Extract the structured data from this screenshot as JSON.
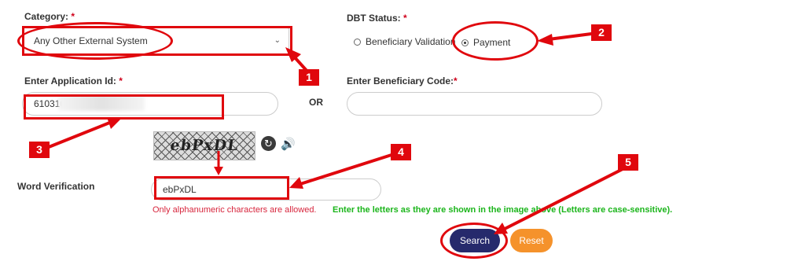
{
  "form": {
    "category": {
      "label": "Category:",
      "required": "*",
      "value": "Any Other External System",
      "chevron": "chevron-down-icon"
    },
    "dbt_status": {
      "label": "DBT Status:",
      "required": "*",
      "options": [
        {
          "label": "Beneficiary Validation",
          "selected": false
        },
        {
          "label": "Payment",
          "selected": true
        }
      ]
    },
    "application_id": {
      "label": "Enter Application Id:",
      "required": "*",
      "value": "610310"
    },
    "or_text": "OR",
    "beneficiary_code": {
      "label": "Enter Beneficiary Code:",
      "required": "*",
      "value": ""
    },
    "captcha": {
      "text": "ebPxDL",
      "refresh_icon": "refresh-icon",
      "audio_icon": "speaker-icon"
    },
    "word_verification": {
      "label": "Word Verification",
      "value": "ebPxDL",
      "error": "Only alphanumeric characters are allowed.",
      "hint": "Enter the letters as they are shown in the image above (Letters are case-sensitive)."
    },
    "buttons": {
      "search": "Search",
      "reset": "Reset"
    }
  },
  "annotations": {
    "color": "#e0070d",
    "steps": [
      "1",
      "2",
      "3",
      "4",
      "5"
    ]
  }
}
